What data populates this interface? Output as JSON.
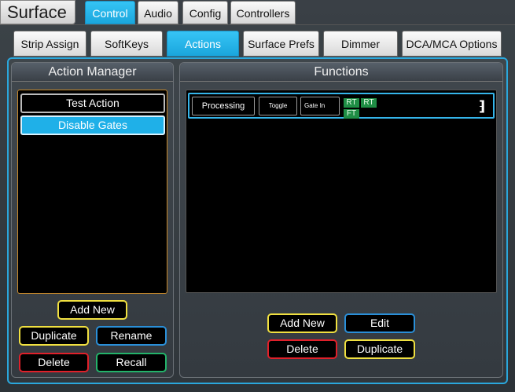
{
  "app": {
    "title": "Surface"
  },
  "top_tabs": [
    {
      "label": "Control",
      "active": true
    },
    {
      "label": "Audio",
      "active": false
    },
    {
      "label": "Config",
      "active": false
    },
    {
      "label": "Controllers",
      "active": false
    }
  ],
  "sub_tabs": [
    {
      "label": "Strip Assign",
      "active": false
    },
    {
      "label": "SoftKeys",
      "active": false
    },
    {
      "label": "Actions",
      "active": true
    },
    {
      "label": "Surface Prefs",
      "active": false
    },
    {
      "label": "Dimmer",
      "active": false
    },
    {
      "label": "DCA/MCA Options",
      "active": false
    }
  ],
  "action_manager": {
    "title": "Action Manager",
    "items": [
      {
        "label": "Test Action",
        "selected": false
      },
      {
        "label": "Disable Gates",
        "selected": true
      }
    ],
    "buttons": {
      "add_new": "Add New",
      "duplicate": "Duplicate",
      "rename": "Rename",
      "delete": "Delete",
      "recall": "Recall"
    }
  },
  "functions": {
    "title": "Functions",
    "rows": [
      {
        "category": "Processing",
        "mode": "Toggle",
        "target": "Gate In",
        "flags": [
          "RT",
          "RT",
          "FT"
        ]
      }
    ],
    "buttons": {
      "add_new": "Add New",
      "edit": "Edit",
      "delete": "Delete",
      "duplicate": "Duplicate"
    }
  },
  "colors": {
    "accent": "#1fb0e8",
    "flag_green": "#1f8e45",
    "yellow_btn": "#f0e040",
    "blue_btn": "#2a8fd8",
    "red_btn": "#e0202a",
    "green_btn": "#23b36a"
  }
}
